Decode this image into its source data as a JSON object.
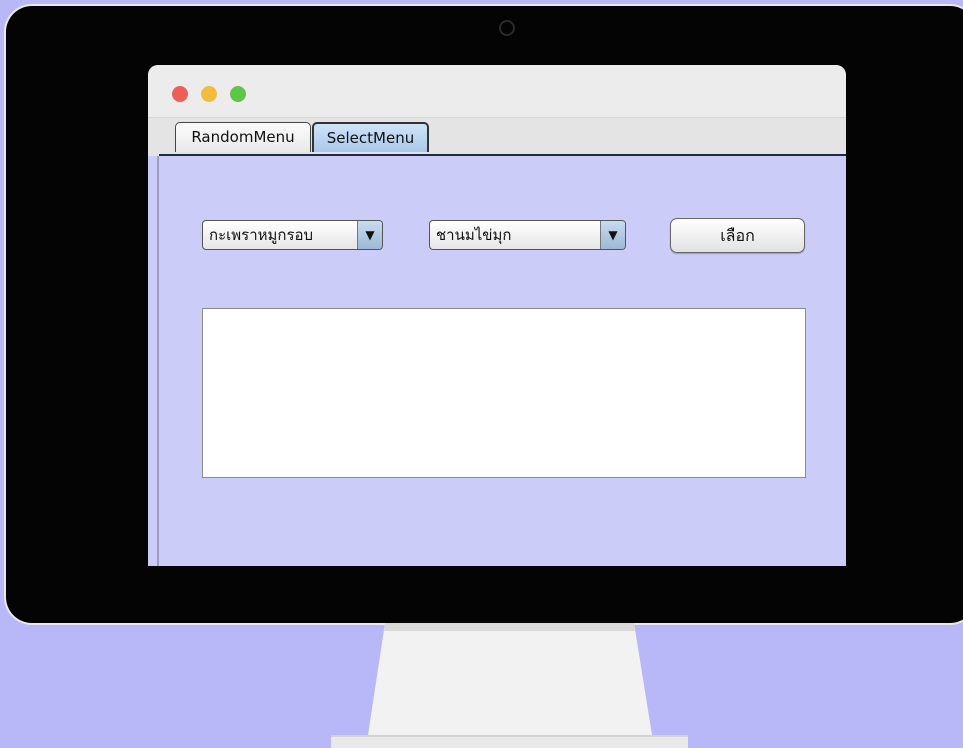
{
  "window": {
    "tabs": [
      {
        "label": "RandomMenu",
        "selected": false
      },
      {
        "label": "SelectMenu",
        "selected": true
      }
    ]
  },
  "select_menu": {
    "food_combo": {
      "value": "กะเพราหมูกรอบ"
    },
    "drink_combo": {
      "value": "ชานมไข่มุก"
    },
    "dropdown_arrow": "▼",
    "choose_button": {
      "label": "เลือก"
    },
    "result_text": ""
  },
  "colors": {
    "background": "#b8b8f8",
    "panel": "#ccccf9",
    "selected_tab": "#a9c8ea",
    "close": "#ec5f57",
    "minimize": "#f2bd3e",
    "maximize": "#5ec547"
  }
}
